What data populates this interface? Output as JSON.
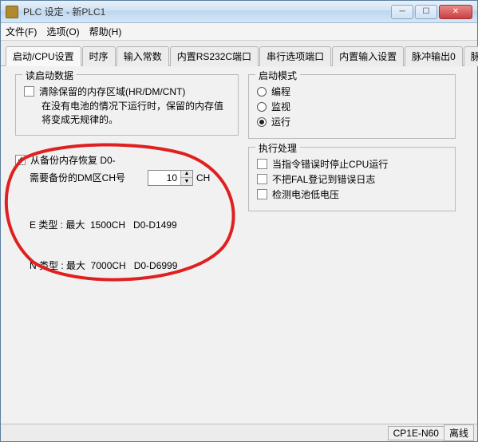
{
  "window": {
    "title": "PLC 设定 - 新PLC1",
    "min": "─",
    "max": "☐",
    "close": "✕"
  },
  "menu": {
    "file": "文件(F)",
    "options": "选项(O)",
    "help": "帮助(H)"
  },
  "tabs": {
    "t0": "启动/CPU设置",
    "t1": "时序",
    "t2": "输入常数",
    "t3": "内置RS232C端口",
    "t4": "串行选项端口",
    "t5": "内置输入设置",
    "t6": "脉冲输出0",
    "t7": "脉",
    "scroll": "▸"
  },
  "groups": {
    "readStartup": {
      "legend": "读启动数据",
      "clearRetain": "清除保留的内存区域(HR/DM/CNT)",
      "note": "在没有电池的情况下运行时，保留的内存值将变成无规律的。"
    },
    "restore": {
      "enable": "从备份内存恢复 D0-",
      "field_label": "需要备份的DM区CH号",
      "value": "10",
      "unit": "CH",
      "line1": "E 类型 : 最大  1500CH   D0-D1499",
      "line2": "N 类型 : 最大  7000CH   D0-D6999"
    },
    "startupMode": {
      "legend": "启动模式",
      "prog": "编程",
      "monitor": "监视",
      "run": "运行"
    },
    "exec": {
      "legend": "执行处理",
      "stopOnErr": "当指令错误时停止CPU运行",
      "noFAL": "不把FAL登记到错误日志",
      "lowBatt": "检测电池低电压"
    }
  },
  "status": {
    "model": "CP1E-N60",
    "conn": "离线"
  }
}
